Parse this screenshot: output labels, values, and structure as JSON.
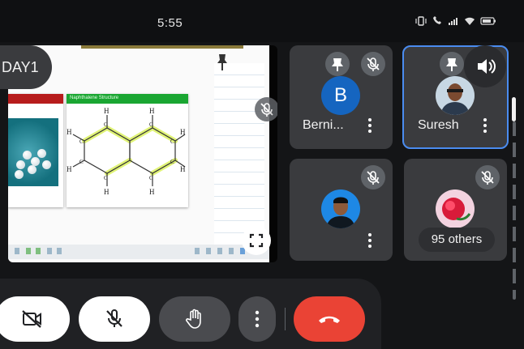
{
  "status_bar": {
    "time": "5:55",
    "icons": [
      "vibrate-icon",
      "call-icon",
      "signal-icon",
      "wifi-icon",
      "battery-icon"
    ]
  },
  "presentation": {
    "label": "DAY1",
    "slide_card_title": "Naphthalene Structure",
    "structure_atoms": [
      "H",
      "H",
      "H",
      "H",
      "H",
      "H",
      "H",
      "H",
      "C",
      "C",
      "C",
      "C",
      "C",
      "C",
      "C",
      "C"
    ]
  },
  "participants": [
    {
      "name": "Berni...",
      "initial": "B",
      "avatar_color": "#1565c0",
      "pinned": true,
      "muted": true,
      "speaking": false
    },
    {
      "name": "Suresh",
      "initial": "",
      "pinned": true,
      "muted": false,
      "speaking": true
    },
    {
      "name": "",
      "initial": "",
      "pinned": false,
      "muted": true,
      "speaking": false
    },
    {
      "name": "",
      "initial": "",
      "pinned": false,
      "muted": true,
      "speaking": false,
      "others_label": "95 others"
    }
  ],
  "controls": [
    "camera-off-button",
    "mic-off-button",
    "raise-hand-button",
    "more-options-button",
    "end-call-button"
  ],
  "colors": {
    "end_call": "#ea4335",
    "speaking_outline": "#4a8cf0",
    "tile_bg": "#3a3b3e",
    "control_bar": "#202124"
  }
}
